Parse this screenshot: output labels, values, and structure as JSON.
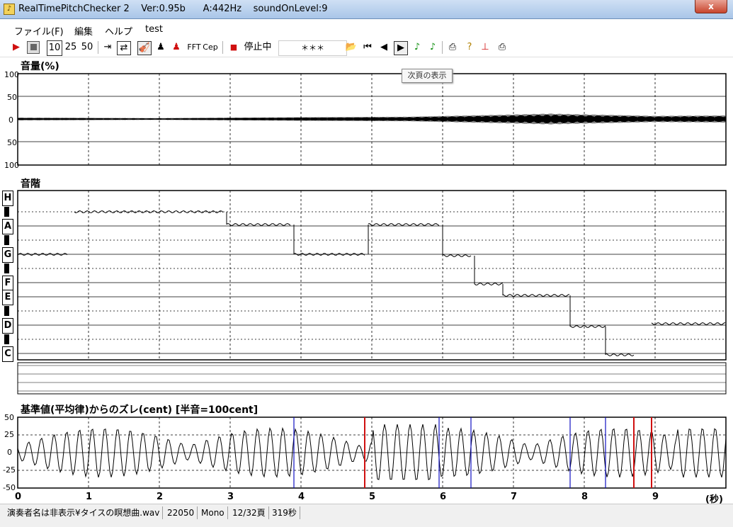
{
  "window": {
    "title": "RealTimePitchChecker 2    Ver:0.95b      A:442Hz    soundOnLevel:9",
    "close_label": "x"
  },
  "menu": {
    "items": [
      "ファイル(F)",
      "編集",
      "ヘルプ",
      "test"
    ]
  },
  "toolbar": {
    "play_icon": "play-icon",
    "speed_10": "10",
    "speed_25": "25",
    "speed_50": "50",
    "fft_label": "FFT",
    "cep_label": "Cep",
    "status_label": "停止中",
    "stars_label": "＊＊＊"
  },
  "tooltip": {
    "text": "次頁の表示"
  },
  "volume_panel": {
    "title": "音量(%)",
    "y_ticks": [
      "100",
      "50",
      "0",
      "50",
      "100"
    ]
  },
  "scale_panel": {
    "title": "音階",
    "notes": [
      "H",
      "A",
      "G",
      "F",
      "E",
      "D",
      "C"
    ]
  },
  "deviation_panel": {
    "title": "基準値(平均律)からのズレ(cent) [半音=100cent]",
    "y_ticks": [
      "50",
      "25",
      "0",
      "-25",
      "-50"
    ],
    "x_ticks": [
      "0",
      "1",
      "2",
      "3",
      "4",
      "5",
      "6",
      "7",
      "8",
      "9"
    ],
    "x_unit": "(秒)"
  },
  "chart_data": [
    {
      "type": "line",
      "title": "音量(%)",
      "ylim": [
        -100,
        100
      ],
      "xlim": [
        0,
        10
      ],
      "grid": true,
      "series": [
        {
          "values_envelope": [
            {
              "x": 0,
              "y": 3
            },
            {
              "x": 2,
              "y": 2
            },
            {
              "x": 4,
              "y": 4
            },
            {
              "x": 5.5,
              "y": 5
            },
            {
              "x": 7,
              "y": 10
            },
            {
              "x": 7.5,
              "y": 12
            },
            {
              "x": 9,
              "y": 7
            },
            {
              "x": 10,
              "y": 8
            }
          ]
        }
      ]
    },
    {
      "type": "line",
      "title": "音階",
      "xlim": [
        0,
        10
      ],
      "notes": [
        "C",
        "D",
        "E",
        "F",
        "G",
        "A",
        "H"
      ],
      "segments": [
        {
          "x0": 0.0,
          "x1": 0.7,
          "note": "G"
        },
        {
          "x0": 0.8,
          "x1": 2.9,
          "note": "H-"
        },
        {
          "x0": 2.95,
          "x1": 3.85,
          "note": "A+"
        },
        {
          "x0": 3.9,
          "x1": 4.9,
          "note": "G"
        },
        {
          "x0": 4.95,
          "x1": 5.95,
          "note": "A+"
        },
        {
          "x0": 6.0,
          "x1": 6.4,
          "note": "G-"
        },
        {
          "x0": 6.45,
          "x1": 6.85,
          "note": "F-"
        },
        {
          "x0": 6.85,
          "x1": 7.8,
          "note": "E+"
        },
        {
          "x0": 7.8,
          "x1": 8.3,
          "note": "D-"
        },
        {
          "x0": 8.3,
          "x1": 8.7,
          "note": "C-"
        },
        {
          "x0": 8.95,
          "x1": 10.0,
          "note": "D+"
        }
      ]
    },
    {
      "type": "line",
      "title": "基準値(平均律)からのズレ(cent) [半音=100cent]",
      "xlim": [
        0,
        10
      ],
      "ylim": [
        -50,
        50
      ],
      "xlabel": "(秒)",
      "markers_blue": [
        3.9,
        5.95,
        6.4,
        7.8,
        8.3,
        8.7
      ],
      "markers_red": [
        4.9,
        8.7,
        8.95
      ]
    }
  ],
  "status": {
    "file": "演奏者名は非表示¥タイスの瞑想曲.wav",
    "rate": "22050",
    "channels": "Mono",
    "page": "12/32頁",
    "seconds": "319秒"
  },
  "colors": {
    "accent_red": "#d01010",
    "marker_blue": "#1010c0",
    "grid": "#000000"
  }
}
